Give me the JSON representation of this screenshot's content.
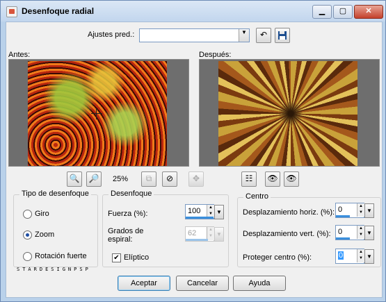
{
  "window": {
    "title": "Desenfoque radial",
    "min_glyph": "▁",
    "max_glyph": "▢",
    "close_glyph": "✕"
  },
  "presets": {
    "label": "Ajustes pred.:",
    "value": "",
    "revert_icon": "undo-arrow-icon",
    "save_icon": "floppy-disk-icon"
  },
  "preview": {
    "before_label": "Antes:",
    "after_label": "Después:",
    "zoom_label": "25%"
  },
  "blur_type": {
    "legend": "Tipo de desenfoque",
    "options": [
      {
        "label": "Giro",
        "selected": false
      },
      {
        "label": "Zoom",
        "selected": true
      },
      {
        "label": "Rotación fuerte",
        "selected": false
      }
    ]
  },
  "blur": {
    "legend": "Desenfoque",
    "strength_label": "Fuerza (%):",
    "strength_value": "100",
    "spiral_label_line1": "Grados de",
    "spiral_label_line2": "espiral:",
    "spiral_value": "62",
    "elliptical_label": "Elíptico",
    "elliptical_checked": true
  },
  "center": {
    "legend": "Centro",
    "hoffset_label": "Desplazamiento horiz. (%):",
    "hoffset_value": "0",
    "voffset_label": "Desplazamiento vert. (%):",
    "voffset_value": "0",
    "protect_label": "Proteger centro (%):",
    "protect_value": "0"
  },
  "watermark": "STARDESIGNPSP",
  "buttons": {
    "ok": "Aceptar",
    "cancel": "Cancelar",
    "help": "Ayuda"
  }
}
